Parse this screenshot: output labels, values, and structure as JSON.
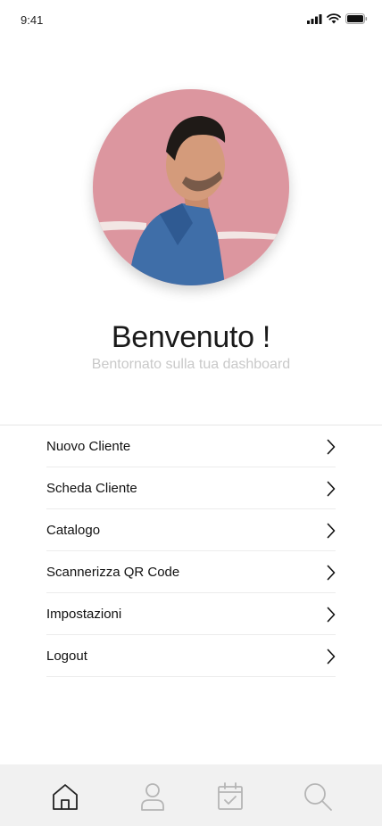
{
  "status_bar": {
    "time": "9:41",
    "icons": [
      "cellular-signal-icon",
      "wifi-icon",
      "battery-icon"
    ]
  },
  "profile": {
    "avatar": "profile-photo",
    "title": "Benvenuto !",
    "subtitle": "Bentornato sulla tua dashboard"
  },
  "menu": {
    "items": [
      {
        "label": "Nuovo Cliente",
        "icon": "chevron-right-icon"
      },
      {
        "label": "Scheda Cliente",
        "icon": "chevron-right-icon"
      },
      {
        "label": "Catalogo",
        "icon": "chevron-right-icon"
      },
      {
        "label": "Scannerizza QR Code",
        "icon": "chevron-right-icon"
      },
      {
        "label": "Impostazioni",
        "icon": "chevron-right-icon"
      },
      {
        "label": "Logout",
        "icon": "chevron-right-icon"
      }
    ]
  },
  "tab_bar": {
    "tabs": [
      {
        "icon": "home-icon",
        "active": true
      },
      {
        "icon": "user-icon",
        "active": false
      },
      {
        "icon": "calendar-check-icon",
        "active": false
      },
      {
        "icon": "search-icon",
        "active": false
      }
    ],
    "active_color": "#222222",
    "inactive_color": "#b5b5b5",
    "background": "#f1f1f1"
  }
}
